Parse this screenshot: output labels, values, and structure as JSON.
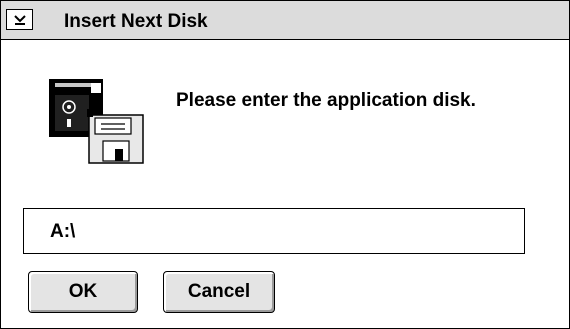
{
  "window": {
    "title": "Insert Next Disk",
    "system_menu_icon": "chevron-down-icon"
  },
  "content": {
    "message": "Please enter the application disk.",
    "icon": "floppy-disks-icon",
    "path_value": "A:\\"
  },
  "buttons": {
    "ok_label": "OK",
    "cancel_label": "Cancel"
  },
  "colors": {
    "titlebar": "#dcdcdc",
    "button_face": "#e4e4e4",
    "background": "#ffffff"
  }
}
